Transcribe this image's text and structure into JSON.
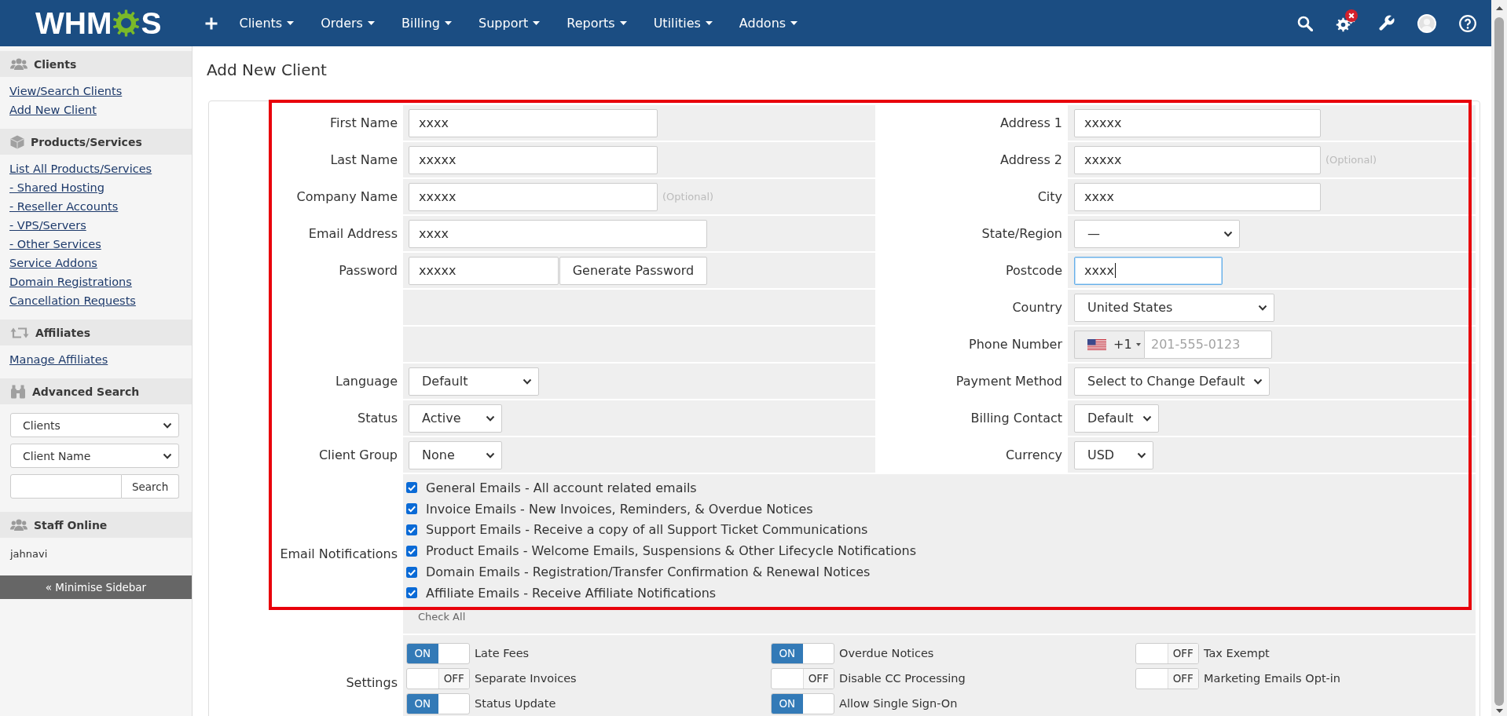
{
  "nav": {
    "logo": [
      "WHM",
      "S"
    ],
    "menu": [
      "Clients",
      "Orders",
      "Billing",
      "Support",
      "Reports",
      "Utilities",
      "Addons"
    ]
  },
  "sidebar": {
    "sections": [
      {
        "kind": "links",
        "title": "Clients",
        "links": [
          "View/Search Clients",
          "Add New Client"
        ]
      },
      {
        "kind": "links",
        "title": "Products/Services",
        "links": [
          "List All Products/Services",
          "- Shared Hosting",
          "- Reseller Accounts",
          "- VPS/Servers",
          "- Other Services",
          "Service Addons",
          "Domain Registrations",
          "Cancellation Requests"
        ]
      },
      {
        "kind": "links",
        "title": "Affiliates",
        "links": [
          "Manage Affiliates"
        ]
      },
      {
        "kind": "search",
        "title": "Advanced Search",
        "selects": [
          "Clients",
          "Client Name"
        ],
        "button": "Search"
      },
      {
        "kind": "staff",
        "title": "Staff Online",
        "names": [
          "jahnavi"
        ]
      }
    ],
    "minimise": "« Minimise Sidebar"
  },
  "page_title": "Add New Client",
  "form": {
    "rows": [
      {
        "left": {
          "label": "First Name",
          "kind": "text",
          "value": "xxxx",
          "focused": false
        },
        "right": {
          "label": "Address 1",
          "kind": "text",
          "value": "xxxxx",
          "focused": false
        }
      },
      {
        "left": {
          "label": "Last Name",
          "kind": "text",
          "value": "xxxxx",
          "focused": false
        },
        "right": {
          "label": "Address 2",
          "kind": "text",
          "value": "xxxxx",
          "focused": false,
          "note": "(Optional)"
        }
      },
      {
        "left": {
          "label": "Company Name",
          "kind": "text",
          "value": "xxxxx",
          "focused": false,
          "note": "(Optional)"
        },
        "right": {
          "label": "City",
          "kind": "text",
          "value": "xxxx",
          "focused": false
        }
      },
      {
        "left": {
          "label": "Email Address",
          "kind": "text",
          "value": "xxxx",
          "focused": false
        },
        "right": {
          "label": "State/Region",
          "kind": "select",
          "value": "—"
        }
      },
      {
        "left": {
          "label": "Password",
          "kind": "password",
          "value": "xxxxx",
          "focused": false,
          "button": "Generate Password"
        },
        "right": {
          "label": "Postcode",
          "kind": "text",
          "value": "xxxx",
          "focused": true
        }
      },
      {
        "right": {
          "label": "Country",
          "kind": "select",
          "value": "United States"
        }
      },
      {
        "right": {
          "label": "Phone Number",
          "kind": "phone",
          "code": "+1",
          "placeholder": "201-555-0123"
        }
      },
      {
        "left": {
          "label": "Language",
          "kind": "select",
          "value": "Default"
        },
        "right": {
          "label": "Payment Method",
          "kind": "select",
          "value": "Select to Change Default"
        }
      },
      {
        "left": {
          "label": "Status",
          "kind": "select",
          "value": "Active"
        },
        "right": {
          "label": "Billing Contact",
          "kind": "select",
          "value": "Default"
        }
      },
      {
        "left": {
          "label": "Client Group",
          "kind": "select",
          "value": "None"
        },
        "right": {
          "label": "Currency",
          "kind": "select",
          "value": "USD"
        }
      }
    ],
    "notifications": {
      "label": "Email Notifications",
      "items": [
        {
          "label": "General Emails - All account related emails",
          "checked": true
        },
        {
          "label": "Invoice Emails - New Invoices, Reminders, & Overdue Notices",
          "checked": true
        },
        {
          "label": "Support Emails - Receive a copy of all Support Ticket Communications",
          "checked": true
        },
        {
          "label": "Product Emails - Welcome Emails, Suspensions & Other Lifecycle Notifications",
          "checked": true
        },
        {
          "label": "Domain Emails - Registration/Transfer Confirmation & Renewal Notices",
          "checked": true
        },
        {
          "label": "Affiliate Emails - Receive Affiliate Notifications",
          "checked": true
        }
      ],
      "check_all": "Check All"
    },
    "settings": {
      "label": "Settings",
      "items": [
        {
          "label": "Late Fees",
          "on": true,
          "toggle_text": "ON"
        },
        {
          "label": "Overdue Notices",
          "on": true,
          "toggle_text": "ON"
        },
        {
          "label": "Tax Exempt",
          "on": false,
          "toggle_text": "OFF"
        },
        {
          "label": "Separate Invoices",
          "on": false,
          "toggle_text": "OFF"
        },
        {
          "label": "Disable CC Processing",
          "on": false,
          "toggle_text": "OFF"
        },
        {
          "label": "Marketing Emails Opt-in",
          "on": false,
          "toggle_text": "OFF"
        },
        {
          "label": "Status Update",
          "on": true,
          "toggle_text": "ON"
        },
        {
          "label": "Allow Single Sign-On",
          "on": true,
          "toggle_text": "ON"
        }
      ]
    }
  }
}
